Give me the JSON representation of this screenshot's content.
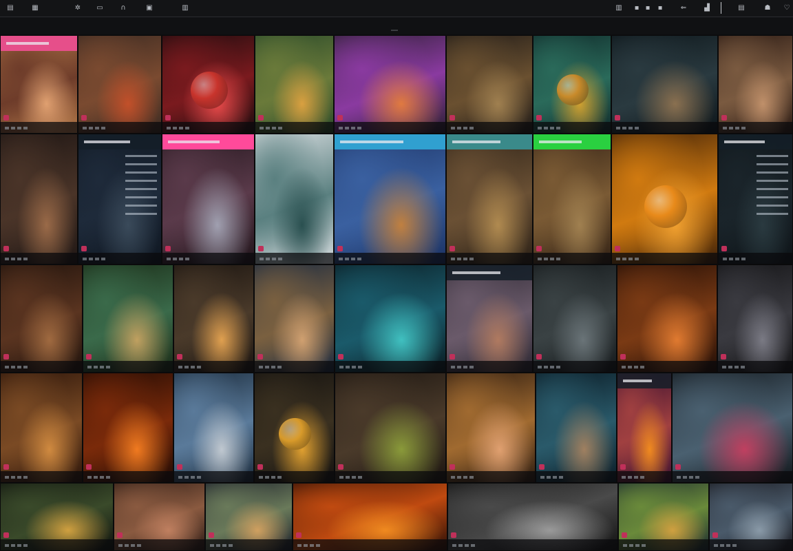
{
  "topbar": {
    "left_icons": [
      "app-icon",
      "tools-icon",
      "settings-icon",
      "chat-icon",
      "headphones-icon",
      "window-icon",
      "menu-icon"
    ],
    "right_icons": [
      "folder-icon",
      "tag-icon",
      "tag-icon",
      "tag-icon",
      "back-icon",
      "layout-icon",
      "options-icon",
      "user-icon",
      "heart-icon"
    ]
  },
  "tiles": [
    {
      "kind": "art",
      "colors": [
        "#b47a4a",
        "#6e3c2a",
        "#e0a070"
      ],
      "accent": "#e64f8a",
      "header": true
    },
    {
      "kind": "art",
      "colors": [
        "#3a2a22",
        "#7a4a30",
        "#c2502a"
      ]
    },
    {
      "kind": "art",
      "colors": [
        "#1a0c0e",
        "#7a1a1e",
        "#e84a4a"
      ],
      "circle": "#c8342c"
    },
    {
      "kind": "art",
      "colors": [
        "#2a4a2a",
        "#6a7a3a",
        "#d9a040"
      ]
    },
    {
      "kind": "art",
      "colors": [
        "#2a2030",
        "#8a3aa0",
        "#e07a40"
      ],
      "accent": "#6a3ad0"
    },
    {
      "kind": "art",
      "colors": [
        "#1e1a18",
        "#6a5030",
        "#a08050"
      ]
    },
    {
      "kind": "art",
      "colors": [
        "#102a2a",
        "#2a6a5a",
        "#d0a030"
      ],
      "circle": "#c88a2a"
    },
    {
      "kind": "art",
      "colors": [
        "#0c1418",
        "#2a3a40",
        "#8a7050"
      ]
    },
    {
      "kind": "art",
      "colors": [
        "#2a1a14",
        "#7a5a40",
        "#c0906a"
      ]
    },
    {
      "kind": "art",
      "colors": [
        "#1e1614",
        "#4a3428",
        "#9a6a48"
      ]
    },
    {
      "kind": "ui",
      "colors": [
        "#0e1620",
        "#1e2a3a",
        "#3a4a5a"
      ],
      "header": true
    },
    {
      "kind": "art",
      "colors": [
        "#20141a",
        "#5a3a4a",
        "#a0a0b0"
      ],
      "accent": "#ff4a9a",
      "header": true
    },
    {
      "kind": "art",
      "colors": [
        "#d8dde0",
        "#5a8080",
        "#2a5050"
      ]
    },
    {
      "kind": "art",
      "colors": [
        "#1a3060",
        "#3a60a0",
        "#c08040"
      ],
      "accent": "#30a0d0",
      "header": true
    },
    {
      "kind": "art",
      "colors": [
        "#2a2016",
        "#6a5034",
        "#b08a50"
      ],
      "accent": "#3a8a8a",
      "header": true
    },
    {
      "kind": "art",
      "colors": [
        "#302014",
        "#7a5a34",
        "#a08050"
      ],
      "accent": "#2ad040",
      "header": true
    },
    {
      "kind": "art",
      "colors": [
        "#3a1e08",
        "#d07a10",
        "#f0a030"
      ],
      "circle": "#e88a1a"
    },
    {
      "kind": "ui",
      "colors": [
        "#0e1418",
        "#1a242a",
        "#2a3a40"
      ],
      "header": true
    },
    {
      "kind": "art",
      "colors": [
        "#1e120c",
        "#5a3420",
        "#a06a40"
      ]
    },
    {
      "kind": "art",
      "colors": [
        "#1a2a16",
        "#3a6a4a",
        "#c0a060"
      ]
    },
    {
      "kind": "art",
      "colors": [
        "#1a1410",
        "#4a3a2a",
        "#e0a050"
      ]
    },
    {
      "kind": "art",
      "colors": [
        "#1a2a40",
        "#7a6040",
        "#d0a070"
      ]
    },
    {
      "kind": "art",
      "colors": [
        "#0a1a20",
        "#1a5a6a",
        "#40c0c0"
      ]
    },
    {
      "kind": "art",
      "colors": [
        "#2a2630",
        "#6a5a6a",
        "#b07a60"
      ],
      "header": true
    },
    {
      "kind": "art",
      "colors": [
        "#14181a",
        "#3a4244",
        "#6a7478"
      ]
    },
    {
      "kind": "art",
      "colors": [
        "#1e0c06",
        "#7a3a14",
        "#e07a30"
      ]
    },
    {
      "kind": "art",
      "colors": [
        "#141416",
        "#3a3a40",
        "#7a7a84"
      ]
    },
    {
      "kind": "art",
      "colors": [
        "#2a140a",
        "#7a4a24",
        "#d08a40"
      ]
    },
    {
      "kind": "art",
      "colors": [
        "#1e0a04",
        "#7a2a0a",
        "#f07a20"
      ]
    },
    {
      "kind": "art",
      "colors": [
        "#1a2a3a",
        "#5a7a9a",
        "#c0c8d0"
      ]
    },
    {
      "kind": "art",
      "colors": [
        "#141210",
        "#3a3020",
        "#e0a030"
      ],
      "circle": "#d89a2a"
    },
    {
      "kind": "art",
      "colors": [
        "#1a1410",
        "#4a3a2a",
        "#8a9a3a"
      ]
    },
    {
      "kind": "art",
      "colors": [
        "#2a1a10",
        "#a06a30",
        "#e0a070"
      ]
    },
    {
      "kind": "art",
      "colors": [
        "#0a1a24",
        "#2a5a6a",
        "#a08060"
      ]
    },
    {
      "kind": "art",
      "colors": [
        "#3a1030",
        "#a04040",
        "#f08a20"
      ],
      "header": true
    },
    {
      "kind": "art",
      "colors": [
        "#101418",
        "#4a6070",
        "#c04060"
      ]
    },
    {
      "kind": "art",
      "colors": [
        "#0e120e",
        "#3a4a2a",
        "#d0a040"
      ]
    },
    {
      "kind": "art",
      "colors": [
        "#2a1a14",
        "#8a5a40",
        "#c08060"
      ]
    },
    {
      "kind": "art",
      "colors": [
        "#1a1e2a",
        "#6a7a5a",
        "#d0a060"
      ]
    },
    {
      "kind": "art",
      "colors": [
        "#2a0e06",
        "#c04a10",
        "#f08a20"
      ]
    },
    {
      "kind": "art",
      "colors": [
        "#101010",
        "#4a4a4a",
        "#9a9a9a"
      ]
    },
    {
      "kind": "art",
      "colors": [
        "#1a2a30",
        "#6a8a3a",
        "#d0a040"
      ]
    },
    {
      "kind": "art",
      "colors": [
        "#1a1a20",
        "#4a5a6a",
        "#8a9aa8"
      ]
    },
    {
      "kind": "art",
      "colors": [
        "#2a2010",
        "#8a7020",
        "#d0a030"
      ]
    }
  ]
}
